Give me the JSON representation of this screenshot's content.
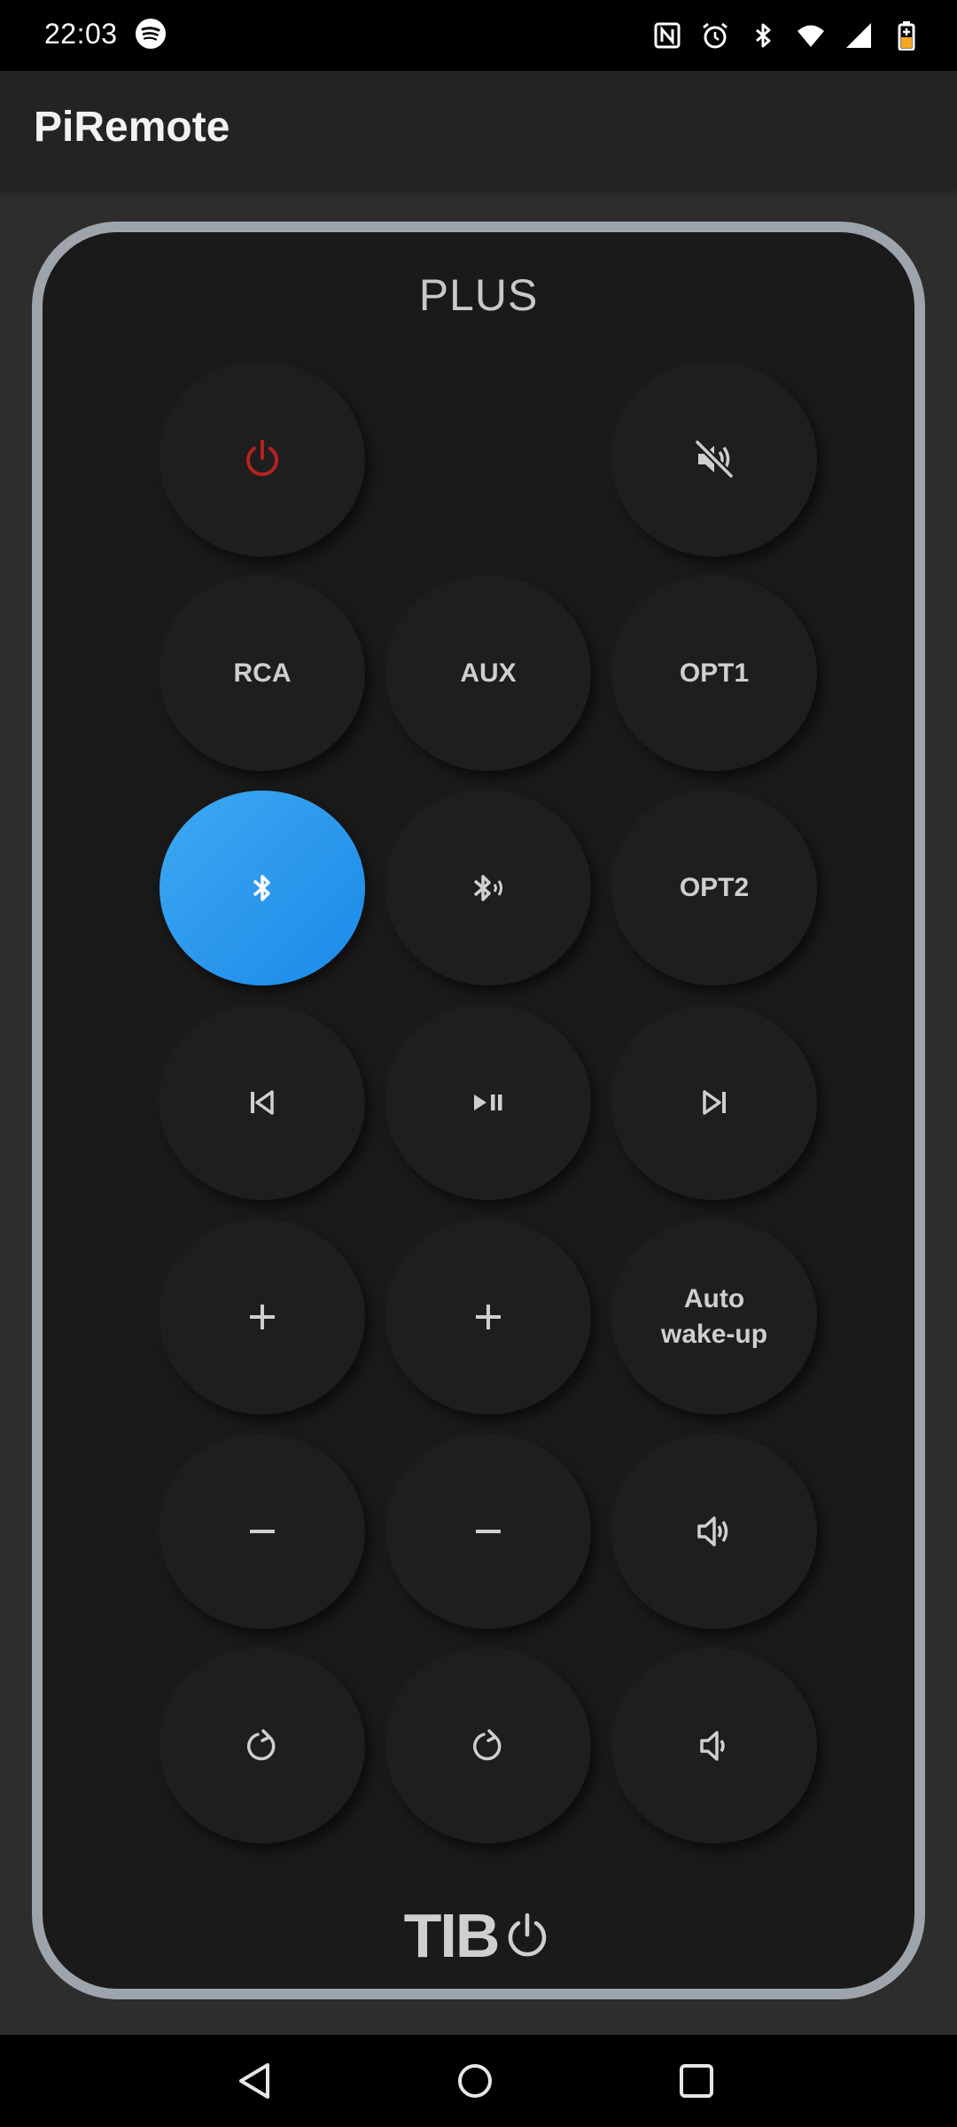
{
  "status_bar": {
    "time": "22:03",
    "icons": [
      "spotify-icon",
      "nfc-icon",
      "alarm-icon",
      "bluetooth-icon",
      "wifi-icon",
      "signal-icon",
      "battery-icon"
    ]
  },
  "app_bar": {
    "title": "PiRemote"
  },
  "remote": {
    "title": "PLUS",
    "logo_text": "TIB",
    "accent_color": "#1f8fe9",
    "buttons": {
      "power": {
        "icon": "power-icon",
        "color": "#b3221f"
      },
      "mute": {
        "icon": "volume-off-icon"
      },
      "rca": {
        "label": "RCA"
      },
      "aux": {
        "label": "AUX"
      },
      "opt1": {
        "label": "OPT1"
      },
      "bluetooth": {
        "icon": "bluetooth-icon",
        "active": true
      },
      "bluetooth_audio": {
        "icon": "bluetooth-audio-icon"
      },
      "opt2": {
        "label": "OPT2"
      },
      "previous": {
        "icon": "skip-previous-icon"
      },
      "play_pause": {
        "icon": "play-pause-icon"
      },
      "next": {
        "icon": "skip-next-icon"
      },
      "plus_left": {
        "icon": "plus-icon"
      },
      "plus_middle": {
        "icon": "plus-icon"
      },
      "auto_wakeup": {
        "label_line1": "Auto",
        "label_line2": "wake-up"
      },
      "minus_left": {
        "icon": "minus-icon"
      },
      "minus_middle": {
        "icon": "minus-icon"
      },
      "volume_up": {
        "icon": "volume-up-icon"
      },
      "reset_left": {
        "icon": "reset-icon"
      },
      "reset_middle": {
        "icon": "reset-icon"
      },
      "volume_down": {
        "icon": "volume-down-icon"
      }
    }
  },
  "nav_bar": {
    "items": [
      "back-icon",
      "home-icon",
      "recents-icon"
    ]
  }
}
